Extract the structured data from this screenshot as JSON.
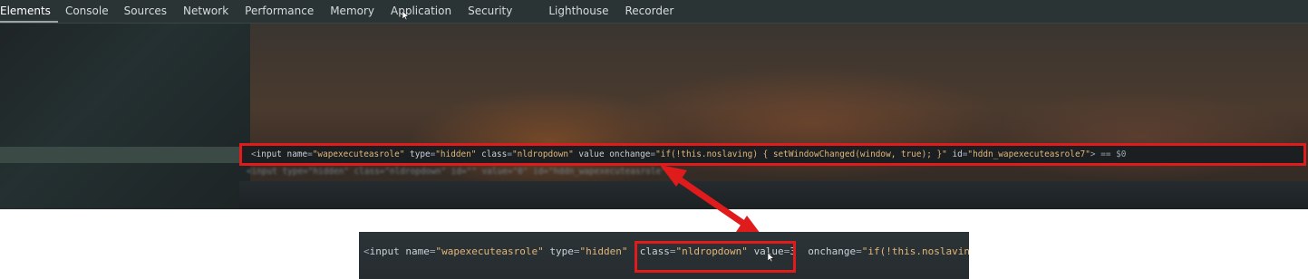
{
  "devtools": {
    "tabs": [
      {
        "label": "Elements",
        "active": true
      },
      {
        "label": "Console",
        "active": false
      },
      {
        "label": "Sources",
        "active": false
      },
      {
        "label": "Network",
        "active": false
      },
      {
        "label": "Performance",
        "active": false
      },
      {
        "label": "Memory",
        "active": false
      },
      {
        "label": "Application",
        "active": false
      },
      {
        "label": "Security",
        "active": false
      },
      {
        "label": "Lighthouse",
        "active": false
      },
      {
        "label": "Recorder",
        "active": false
      }
    ],
    "selected_element_line": {
      "open": "<",
      "tag": "input",
      "name_attr": "name",
      "name_value": "\"wapexecuteasrole\"",
      "type_attr": "type",
      "type_value": "\"hidden\"",
      "class_attr": "class",
      "class_value": "\"nldropdown\"",
      "value_attr": "value",
      "onchange_attr": "onchange",
      "onchange_value": "\"if(!this.noslaving) { setWindowChanged(window, true); }\"",
      "id_attr": "id",
      "id_value": "\"hddn_wapexecuteasrole7\"",
      "close": ">",
      "selected_marker": "== $0"
    },
    "next_line_text": "<input type=\"hidden\" class=\"nldropdown\" id=\"\" value=\"0\" id=\"hddn_wapexecuteasrole\">"
  },
  "zoom_inset": {
    "open": "<",
    "tag": "input",
    "name_attr": "name",
    "name_value": "\"wapexecuteasrole\"",
    "type_attr": "type",
    "type_value": "\"hidden\"",
    "class_attr": "class",
    "class_value": "\"nldropdown\"",
    "value_attr": "value",
    "value_value": "3",
    "onchange_attr": "onchange",
    "onchange_value": "\"if(!this.noslaving)"
  },
  "colors": {
    "highlight": "#e01b1b",
    "attr_value": "#e3b677",
    "devtools_bg": "#232a2b"
  }
}
